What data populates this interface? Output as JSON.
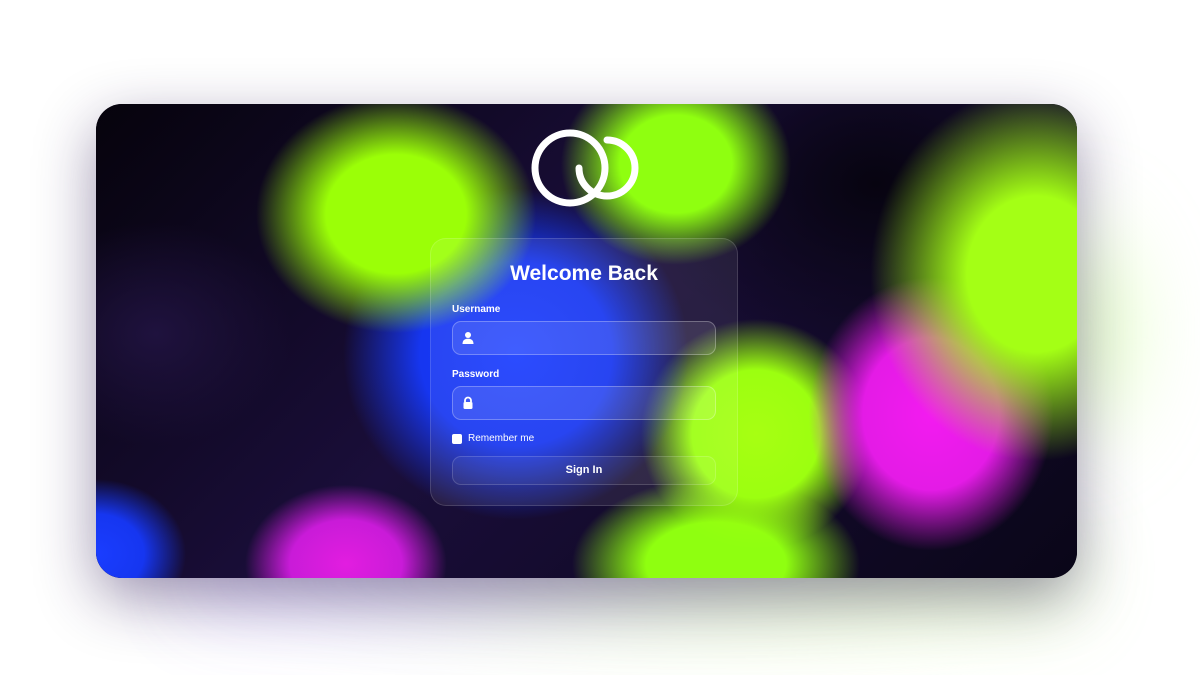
{
  "login": {
    "title": "Welcome Back",
    "username": {
      "label": "Username",
      "value": "",
      "placeholder": ""
    },
    "password": {
      "label": "Password",
      "value": "",
      "placeholder": ""
    },
    "remember_label": "Remember me",
    "remember_checked": false,
    "submit_label": "Sign In"
  },
  "icons": {
    "logo": "interlocking-rings-logo",
    "username": "user-icon",
    "password": "lock-icon"
  },
  "colors": {
    "text": "#ffffff",
    "blob_green": "#9bff07",
    "blob_blue": "#1a3dff",
    "blob_magenta": "#f31bf0",
    "background_dark": "#0b0714"
  }
}
